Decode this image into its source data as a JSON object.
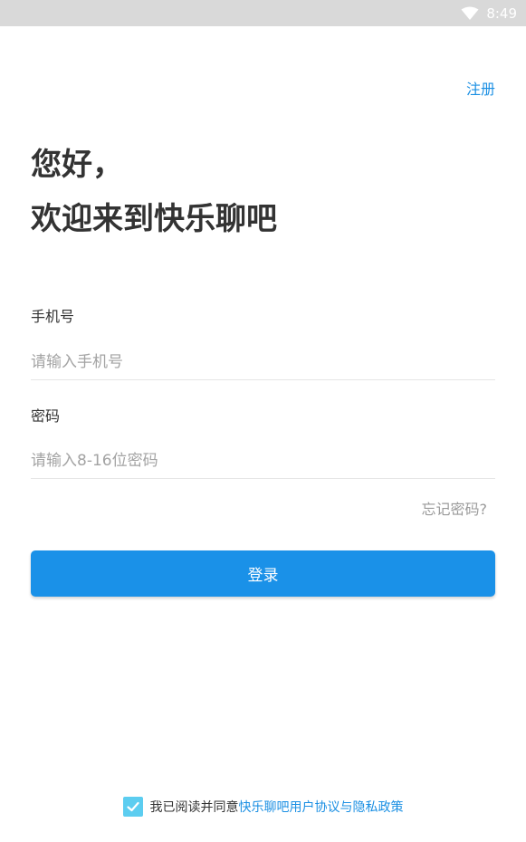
{
  "status_bar": {
    "time": "8:49",
    "icons": [
      "wifi-icon"
    ]
  },
  "header": {
    "register_label": "注册"
  },
  "greeting": {
    "line1": "您好，",
    "line2": "欢迎来到快乐聊吧"
  },
  "phone": {
    "label": "手机号",
    "placeholder": "请输入手机号",
    "value": ""
  },
  "password": {
    "label": "密码",
    "placeholder": "请输入8-16位密码",
    "value": ""
  },
  "forgot_label": "忘记密码?",
  "login_label": "登录",
  "agreement": {
    "checked": true,
    "prefix": "我已阅读并同意",
    "link": "快乐聊吧用户协议与隐私政策"
  },
  "colors": {
    "accent": "#1a91e8",
    "link": "#1a8fe3",
    "checkbox": "#5ccdf0",
    "status_bar": "#d9d9d9"
  }
}
